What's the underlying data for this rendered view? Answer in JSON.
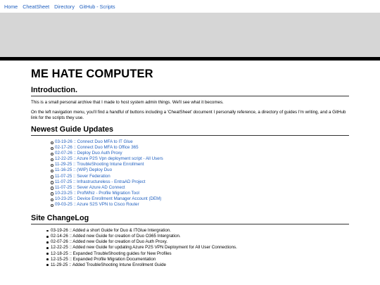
{
  "nav": {
    "links": [
      "Home",
      "CheatSheet",
      "Directory",
      "GitHub - Scripts"
    ]
  },
  "title": "ME HATE COMPUTER",
  "intro": {
    "heading": "Introduction.",
    "p1": "This is a small personal archive that I made to host system admin things. We'll see what it becomes.",
    "p2": "On the left navigation menu, you'll find a handful of buttons including a 'CheatSheet' document I personally reference, a directory of guides I'm writing, and a GitHub link for the scripts they use."
  },
  "updates": {
    "heading": "Newest Guide Updates",
    "items": [
      "03-19-26 :: Connect Duo MFA to IT Glue",
      "02-17-26 :: Connect Duo MFA to Office 365",
      "02-07-26 :: Deploy Duo Auth Proxy",
      "12-22-25 :: Azure P2S Vpn deployment script - All Users",
      "11-29-25 :: TroubleShooting Intune Enrollment",
      "11-16-25 :: (WIP) Deploy Duo",
      "11-07-25 :: Sever Federation",
      "11-07-25 :: Infrastructureless - EntraAD Project",
      "11-07-25 :: Sever Azure AD Connect",
      "10-23-25 :: ProfWhiz - Profile Migration Tool",
      "10-23-25 :: Device Enrollment Manager Account (DEM)",
      "09-03-25 :: Azure S2S VPN to Cisco Router"
    ]
  },
  "changelog": {
    "heading": "Site ChangeLog",
    "items": [
      "03-19-26 :: Added a short Guide for Duo & ITGlue Intergration.",
      "02-14-26 :: Added new Guide for creation of Duo O365 Intergration.",
      "02-07-26 :: Added new Guide for creation of Duo Auth Proxy.",
      "12-22-25 :: Added new Guide for updating Azure P2S VPN Deployment for All User Connections.",
      "12-18-25 :: Expanded TroubleShooting guides for New Profiles",
      "12-15-25 :: Expanded Profile Migration Documentation",
      "11-29-25 :: Added TroubleShooting Intune Enrollment Guide"
    ]
  }
}
